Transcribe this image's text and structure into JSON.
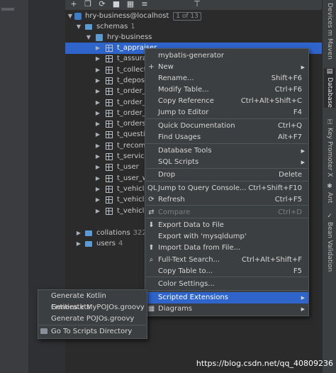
{
  "toolbar": {
    "icons": [
      "add-icon",
      "copy-icon",
      "refresh-icon",
      "stop-icon",
      "table-icon",
      "settings-icon",
      "pin-icon"
    ]
  },
  "tree": {
    "connection": {
      "label": "hry-business@localhost",
      "count": "1 of 13"
    },
    "schemas": {
      "label": "schemas",
      "count": "1"
    },
    "schema": {
      "label": "hry-business"
    },
    "tables": [
      "t_appraiser",
      "t_assurar",
      "t_collect",
      "t_deposit",
      "t_order_c",
      "t_order_p",
      "t_order_v",
      "t_orders",
      "t_question",
      "t_recomm",
      "t_service_",
      "t_user",
      "t_user_w",
      "t_vehicle_",
      "t_vehicle_",
      "t_vehicle_"
    ],
    "collations": {
      "label": "collations",
      "count": "322"
    },
    "users": {
      "label": "users",
      "count": "4"
    }
  },
  "right_tabs": [
    "Devices",
    "Maven",
    "Database",
    "Key Promoter X",
    "Ant",
    "Bean Validation"
  ],
  "context_menu": {
    "items": [
      {
        "label": "mybatis-generator",
        "shortcut": ""
      },
      {
        "label": "New",
        "shortcut": "",
        "arrow": true,
        "icon": "+"
      },
      {
        "label": "Rename...",
        "shortcut": "Shift+F6"
      },
      {
        "label": "Modify Table...",
        "shortcut": "Ctrl+F6"
      },
      {
        "label": "Copy Reference",
        "shortcut": "Ctrl+Alt+Shift+C"
      },
      {
        "label": "Jump to Editor",
        "shortcut": "F4"
      },
      {
        "label": "Quick Documentation",
        "shortcut": "Ctrl+Q"
      },
      {
        "label": "Find Usages",
        "shortcut": "Alt+F7"
      },
      {
        "label": "Database Tools",
        "shortcut": "",
        "arrow": true
      },
      {
        "label": "SQL Scripts",
        "shortcut": "",
        "arrow": true
      },
      {
        "label": "Drop",
        "shortcut": "Delete"
      },
      {
        "label": "Jump to Query Console...",
        "shortcut": "Ctrl+Shift+F10",
        "icon": "QL"
      },
      {
        "label": "Refresh",
        "shortcut": "Ctrl+F5",
        "icon": "⟳"
      },
      {
        "label": "Compare",
        "shortcut": "Ctrl+D",
        "icon": "⇄"
      },
      {
        "label": "Export Data to File",
        "shortcut": "",
        "icon": "⬇"
      },
      {
        "label": "Export with 'mysqldump'",
        "shortcut": ""
      },
      {
        "label": "Import Data from File...",
        "shortcut": "",
        "icon": "⬆"
      },
      {
        "label": "Full-Text Search...",
        "shortcut": "Ctrl+Alt+Shift+F",
        "icon": "⌕"
      },
      {
        "label": "Copy Table to...",
        "shortcut": "F5"
      },
      {
        "label": "Color Settings...",
        "shortcut": ""
      },
      {
        "label": "Scripted Extensions",
        "shortcut": "",
        "arrow": true
      },
      {
        "label": "Diagrams",
        "shortcut": "",
        "arrow": true,
        "icon": "▦"
      }
    ]
  },
  "submenu": {
    "items": [
      {
        "label": "Generate Kotlin Entities.kts"
      },
      {
        "label": "Generate MyPOJOs.groovy"
      },
      {
        "label": "Generate POJOs.groovy"
      },
      {
        "label": "Go To Scripts Directory",
        "icon": "folder"
      }
    ]
  },
  "watermark": "https://blog.csdn.net/qq_40809236"
}
